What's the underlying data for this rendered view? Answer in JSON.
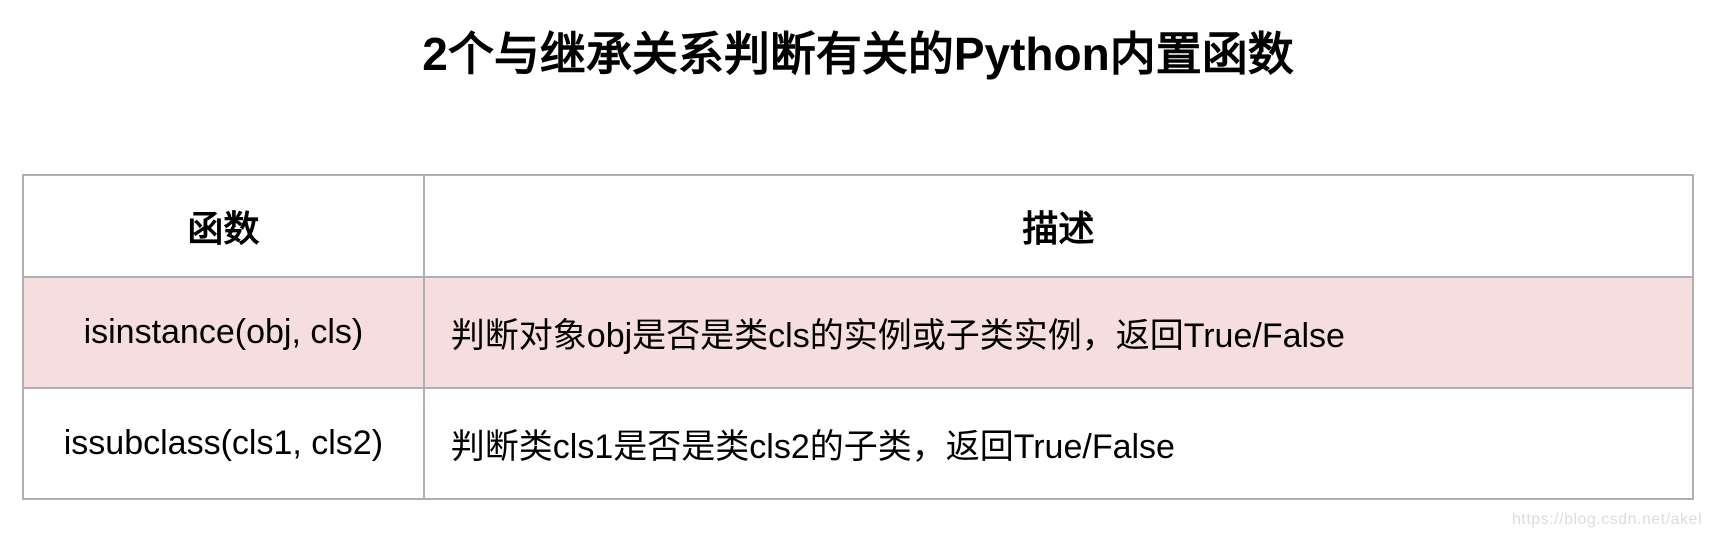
{
  "title": "2个与继承关系判断有关的Python内置函数",
  "headers": {
    "fn": "函数",
    "desc": "描述"
  },
  "rows": [
    {
      "fn": "isinstance(obj, cls)",
      "desc": "判断对象obj是否是类cls的实例或子类实例，返回True/False",
      "highlight": true
    },
    {
      "fn": "issubclass(cls1, cls2)",
      "desc": "判断类cls1是否是类cls2的子类，返回True/False",
      "highlight": false
    }
  ],
  "watermark": "https://blog.csdn.net/akel"
}
